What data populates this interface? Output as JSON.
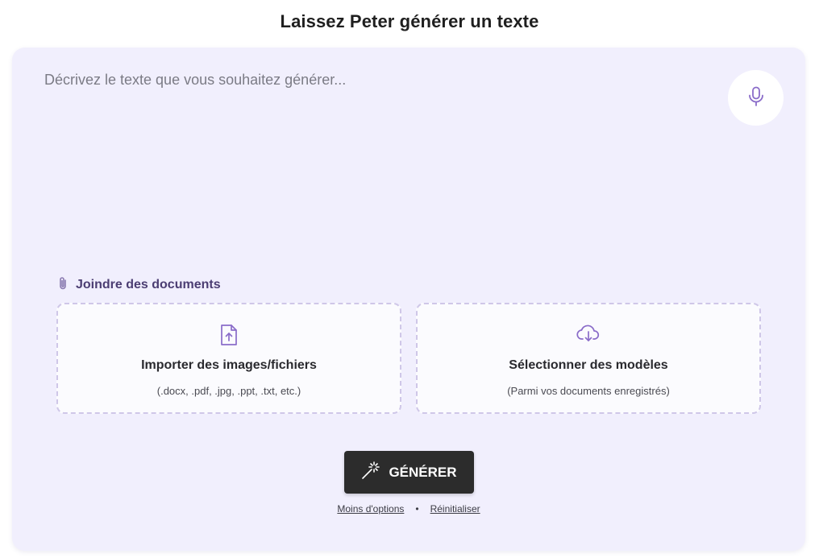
{
  "page": {
    "title": "Laissez Peter générer un texte"
  },
  "prompt": {
    "placeholder": "Décrivez le texte que vous souhaitez générer...",
    "value": ""
  },
  "mic": {
    "icon": "microphone-icon"
  },
  "attachments": {
    "title": "Joindre des documents",
    "icon": "paperclip-icon",
    "upload": {
      "title": "Importer des images/fichiers",
      "subtitle": "(.docx, .pdf, .jpg, .ppt, .txt, etc.)",
      "icon": "file-upload-icon"
    },
    "templates": {
      "title": "Sélectionner des modèles",
      "subtitle": "(Parmi vos documents enregistrés)",
      "icon": "cloud-download-icon"
    }
  },
  "actions": {
    "generate_label": "GÉNÉRER",
    "generate_icon": "magic-wand-icon",
    "less_options": "Moins d'options",
    "separator": "•",
    "reset": "Réinitialiser"
  },
  "colors": {
    "card_bg": "#f1effd",
    "accent": "#8a6cc9",
    "button_bg": "#2c2c2c"
  }
}
